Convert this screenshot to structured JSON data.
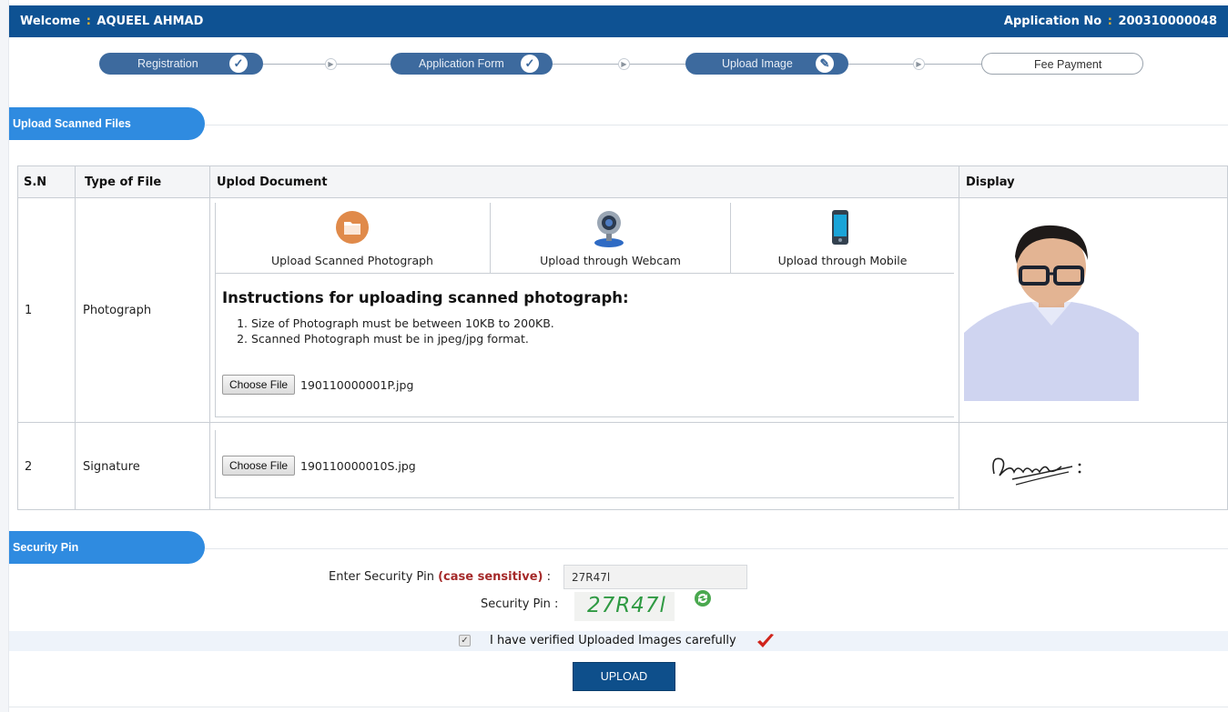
{
  "header": {
    "welcome_label": "Welcome",
    "sep": ":",
    "user_name": "AQUEEL AHMAD",
    "appno_label": "Application No",
    "appno_value": "200310000048"
  },
  "steps": [
    {
      "label": "Registration",
      "status": "done",
      "mark": "✓"
    },
    {
      "label": "Application Form",
      "status": "done",
      "mark": "✓"
    },
    {
      "label": "Upload Image",
      "status": "current",
      "mark": "✎"
    },
    {
      "label": "Fee Payment",
      "status": "pending",
      "mark": ""
    }
  ],
  "sections": {
    "upload_title": "Upload Scanned Files",
    "security_title": "Security Pin"
  },
  "table": {
    "headers": {
      "sn": "S.N",
      "type": "Type of File",
      "doc": "Uplod Document",
      "display": "Display"
    },
    "rows": [
      {
        "sn": "1",
        "type": "Photograph"
      },
      {
        "sn": "2",
        "type": "Signature"
      }
    ],
    "options": [
      {
        "label": "Upload Scanned Photograph",
        "icon": "folder-icon"
      },
      {
        "label": "Upload through Webcam",
        "icon": "webcam-icon"
      },
      {
        "label": "Upload through Mobile",
        "icon": "mobile-icon"
      }
    ],
    "instructions_title": "Instructions for uploading scanned photograph:",
    "instructions": [
      "Size of Photograph must be between 10KB to 200KB.",
      "Scanned Photograph must be in jpeg/jpg format."
    ],
    "choose_file_label": "Choose File",
    "photo_file": "190110000001P.jpg",
    "signature_file": "190110000010S.jpg"
  },
  "security": {
    "enter_label": "Enter Security Pin",
    "case_note": "(case sensitive)",
    "colon": ":",
    "input_value": "27R47l",
    "pin_label": "Security Pin :",
    "pin_captcha": "27R47l"
  },
  "verify": {
    "text": "I have verified Uploaded Images carefully",
    "checked": true
  },
  "upload_button": "UPLOAD",
  "colors": {
    "header_bg": "#0e5293",
    "section_tab": "#2f8be0",
    "step_done": "#3d6a9e",
    "accent_red": "#d0241b",
    "captcha_green": "#2f9a43"
  }
}
